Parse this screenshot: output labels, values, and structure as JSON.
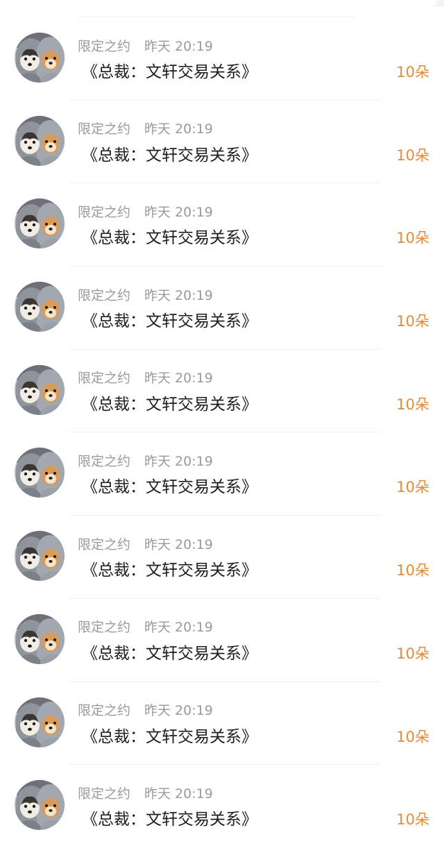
{
  "colors": {
    "background": "#ffffff",
    "meta_text": "#9a9a9a",
    "title_text": "#1e1e1e",
    "amount_accent": "#e58a3a",
    "divider": "#f0f0f0"
  },
  "records": [
    {
      "avatar": "dogs-avatar-icon",
      "user": "限定之约",
      "time": "昨天 20:19",
      "title": "《总裁：文轩交易关系》",
      "amount": "10朵"
    },
    {
      "avatar": "dogs-avatar-icon",
      "user": "限定之约",
      "time": "昨天 20:19",
      "title": "《总裁：文轩交易关系》",
      "amount": "10朵"
    },
    {
      "avatar": "dogs-avatar-icon",
      "user": "限定之约",
      "time": "昨天 20:19",
      "title": "《总裁：文轩交易关系》",
      "amount": "10朵"
    },
    {
      "avatar": "dogs-avatar-icon",
      "user": "限定之约",
      "time": "昨天 20:19",
      "title": "《总裁：文轩交易关系》",
      "amount": "10朵"
    },
    {
      "avatar": "dogs-avatar-icon",
      "user": "限定之约",
      "time": "昨天 20:19",
      "title": "《总裁：文轩交易关系》",
      "amount": "10朵"
    },
    {
      "avatar": "dogs-avatar-icon",
      "user": "限定之约",
      "time": "昨天 20:19",
      "title": "《总裁：文轩交易关系》",
      "amount": "10朵"
    },
    {
      "avatar": "dogs-avatar-icon",
      "user": "限定之约",
      "time": "昨天 20:19",
      "title": "《总裁：文轩交易关系》",
      "amount": "10朵"
    },
    {
      "avatar": "dogs-avatar-icon",
      "user": "限定之约",
      "time": "昨天 20:19",
      "title": "《总裁：文轩交易关系》",
      "amount": "10朵"
    },
    {
      "avatar": "dogs-avatar-icon",
      "user": "限定之约",
      "time": "昨天 20:19",
      "title": "《总裁：文轩交易关系》",
      "amount": "10朵"
    },
    {
      "avatar": "dogs-avatar-icon",
      "user": "限定之约",
      "time": "昨天 20:19",
      "title": "《总裁：文轩交易关系》",
      "amount": "10朵"
    }
  ]
}
